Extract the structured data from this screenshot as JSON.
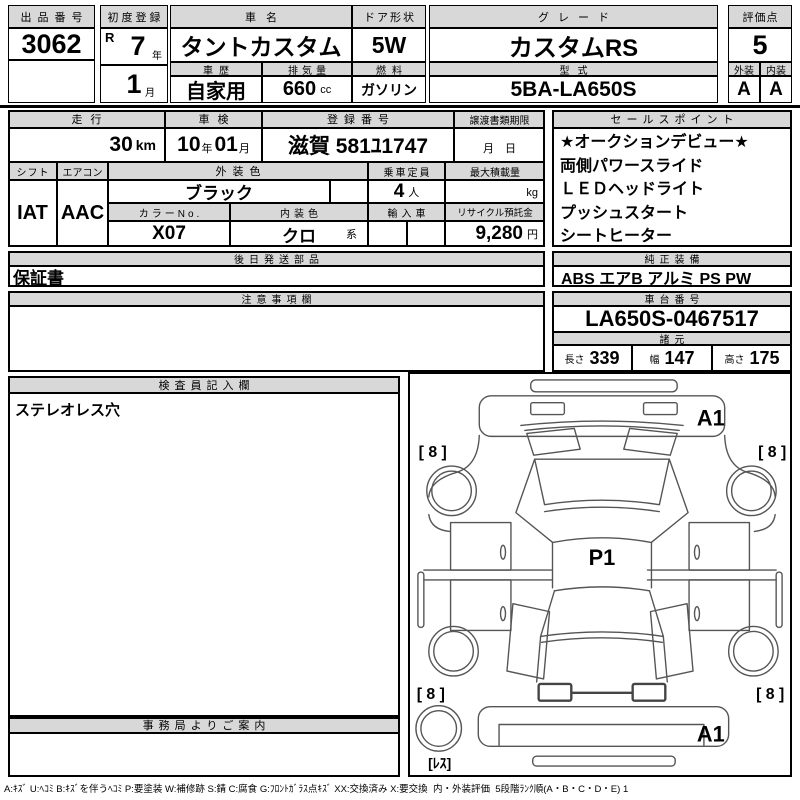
{
  "colors": {
    "header_bg": "#d8d8d8",
    "border": "#000000",
    "diagram_line": "#555555"
  },
  "top": {
    "auction_no": {
      "label": "出品番号",
      "value": "3062"
    },
    "first_reg": {
      "label": "初度登録",
      "era": "R",
      "year": "7",
      "year_unit": "年",
      "month": "1",
      "month_unit": "月"
    },
    "name": {
      "label": "車名",
      "value": "タントカスタム"
    },
    "history": {
      "label": "車歴",
      "value": "自家用"
    },
    "displacement": {
      "label": "排気量",
      "value": "660",
      "unit": "cc"
    },
    "door": {
      "label": "ドア形状",
      "value": "5W"
    },
    "fuel": {
      "label": "燃料",
      "value": "ガソリン"
    },
    "grade": {
      "label": "グレード",
      "value": "カスタムRS"
    },
    "model": {
      "label": "型式",
      "value": "5BA-LA650S"
    },
    "score": {
      "label": "評価点",
      "value": "5"
    },
    "exterior": {
      "label": "外装",
      "value": "A"
    },
    "interior": {
      "label": "内装",
      "value": "A"
    }
  },
  "mid": {
    "mileage": {
      "label": "走行",
      "value": "30",
      "unit": "km"
    },
    "inspection": {
      "label": "車検",
      "year": "10",
      "year_unit": "年",
      "month": "01",
      "month_unit": "月"
    },
    "reg_no": {
      "label": "登録番号",
      "value": "滋賀 581ﾕ1747"
    },
    "transfer": {
      "label": "譲渡書類期限",
      "value": "月　日"
    },
    "shift": {
      "label": "シフト",
      "value": "IAT"
    },
    "aircon": {
      "label": "エアコン",
      "value": "AAC"
    },
    "ext_color": {
      "label": "外装色",
      "value": "ブラック"
    },
    "capacity": {
      "label": "乗車定員",
      "value": "4",
      "unit": "人"
    },
    "max_load": {
      "label": "最大積載量",
      "unit": "kg"
    },
    "color_no": {
      "label": "カラーNo.",
      "value": "X07"
    },
    "int_color": {
      "label": "内装色",
      "value": "クロ",
      "suffix": "系"
    },
    "import_car": {
      "label": "輸入車"
    },
    "recycle": {
      "label": "リサイクル預託金",
      "value": "9,280",
      "unit": "円"
    },
    "sales": {
      "label": "セールスポイント",
      "items": [
        "★オークションデビュー★",
        "両側パワースライド",
        "ＬＥＤヘッドライト",
        "プッシュスタート",
        "シートヒーター"
      ]
    }
  },
  "sections": {
    "later_parts": {
      "label": "後日発送部品",
      "value": "保証書"
    },
    "equipment": {
      "label": "純正装備",
      "value": "ABS エアB アルミ PS PW"
    },
    "notes": {
      "label": "注意事項欄",
      "value": ""
    },
    "chassis": {
      "label": "車台番号",
      "value": "LA650S-0467517"
    },
    "specs": {
      "label": "諸元",
      "length_label": "長さ",
      "length": "339",
      "width_label": "幅",
      "width": "147",
      "height_label": "高さ",
      "height": "175"
    },
    "inspector": {
      "label": "検査員記入欄",
      "value": "ステレオレス穴"
    },
    "office": {
      "label": "事務局よりご案内",
      "value": ""
    }
  },
  "diagram": {
    "front_mark": "A1",
    "roof_mark": "P1",
    "rear_mark": "A1",
    "tire_fl": "[ 8 ]",
    "tire_fr": "[ 8 ]",
    "tire_rl": "[ 8 ]",
    "tire_rr": "[ 8 ]",
    "spare_mark": "[ﾚｽ]"
  },
  "legend": "A:ｷｽﾞ U:ﾍｺﾐ B:ｷｽﾞを伴うﾍｺﾐ P:要塗装 W:補修跡 S:錆 C:腐食 G:ﾌﾛﾝﾄｶﾞﾗｽ点ｷｽﾞ XX:交換済み X:要交換  内・外装評価  5段階ﾗﾝｸ順(A・B・C・D・E) 1"
}
